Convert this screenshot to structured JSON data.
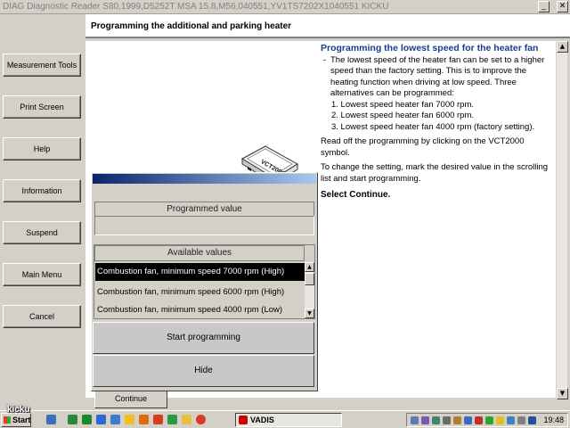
{
  "window": {
    "title": "DIAG Diagnostic Reader S80,1999,D5252T MSA 15.8,M56,040551,YV1TS7202X1040551 KICKU",
    "minimize_glyph": "_",
    "maximize_glyph": "□",
    "close_glyph": "✕"
  },
  "header": {
    "title": "Programming the additional and parking heater"
  },
  "sidebar": {
    "items": [
      {
        "label": "Measurement Tools"
      },
      {
        "label": "Print Screen"
      },
      {
        "label": "Help"
      },
      {
        "label": "Information"
      },
      {
        "label": "Suspend"
      },
      {
        "label": "Main Menu"
      },
      {
        "label": "Cancel"
      }
    ]
  },
  "info": {
    "heading": "Programming the lowest speed for the heater fan",
    "bullet_dash": "-",
    "bullet": "The lowest speed of the heater fan can be set to a higher speed than the factory setting. This is to improve the heating function when driving at low speed. Three alternatives can be programmed:",
    "options": [
      "1. Lowest speed heater fan 7000 rpm.",
      "2. Lowest speed heater fan 6000 rpm.",
      "3. Lowest speed heater fan 4000 rpm (factory setting)."
    ],
    "para1": "Read off the programming by clicking on the VCT2000 symbol.",
    "para2": "To change the setting, mark the desired value in the scrolling list and start programming.",
    "select": "Select Continue."
  },
  "device": {
    "label": "VCT2000"
  },
  "dialog": {
    "programmed_label": "Programmed value",
    "programmed_value": "",
    "available_label": "Available values",
    "list_items": [
      "Combustion fan, minimum speed 7000 rpm (High)",
      "Combustion fan, minimum speed 6000 rpm (High)",
      "Combustion fan, minimum speed 4000 rpm (Low)"
    ],
    "selected_index": 0,
    "start_button": "Start programming",
    "hide_button": "Hide"
  },
  "continue_button": "Continue",
  "taskbar": {
    "start_label": "Start",
    "task_label": "VADIS",
    "clock": "19:48"
  },
  "watermark": "kicku",
  "colors": {
    "accent": "#1a3d8a",
    "selection": "#000000",
    "dialog_title_start": "#0a246a",
    "dialog_title_end": "#a6caf0"
  }
}
